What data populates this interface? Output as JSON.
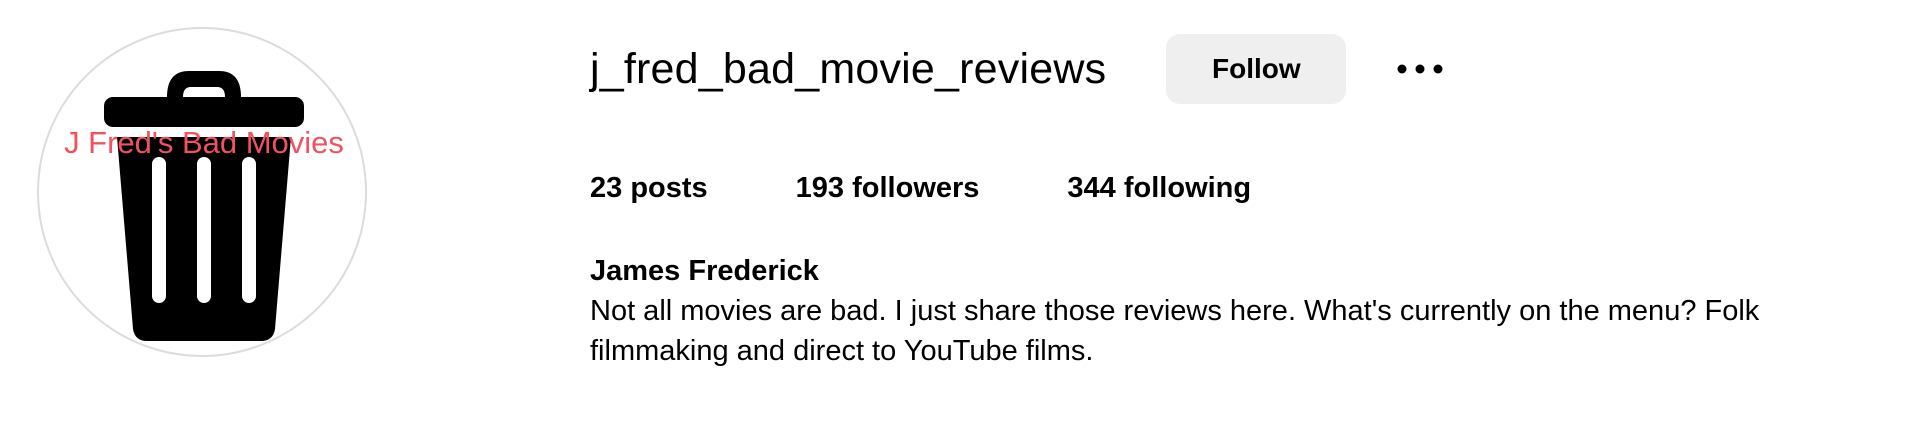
{
  "profile": {
    "username": "j_fred_bad_movie_reviews",
    "follow_label": "Follow",
    "more_icon": "more-options-icon"
  },
  "avatar": {
    "overlay_text": "J Fred's Bad Movies",
    "overlay_color": "#f0525f",
    "icon": "trash-can-icon",
    "icon_color": "#000000",
    "border_color": "#dcdcdc"
  },
  "stats": {
    "posts": "23 posts",
    "followers": "193 followers",
    "following": "344 following"
  },
  "bio": {
    "full_name": "James Frederick",
    "text": "Not all movies are bad. I just share those reviews here. What's currently on the menu? Folk filmmaking and direct to YouTube films."
  },
  "colors": {
    "button_background": "#efefef",
    "text": "#000000"
  }
}
